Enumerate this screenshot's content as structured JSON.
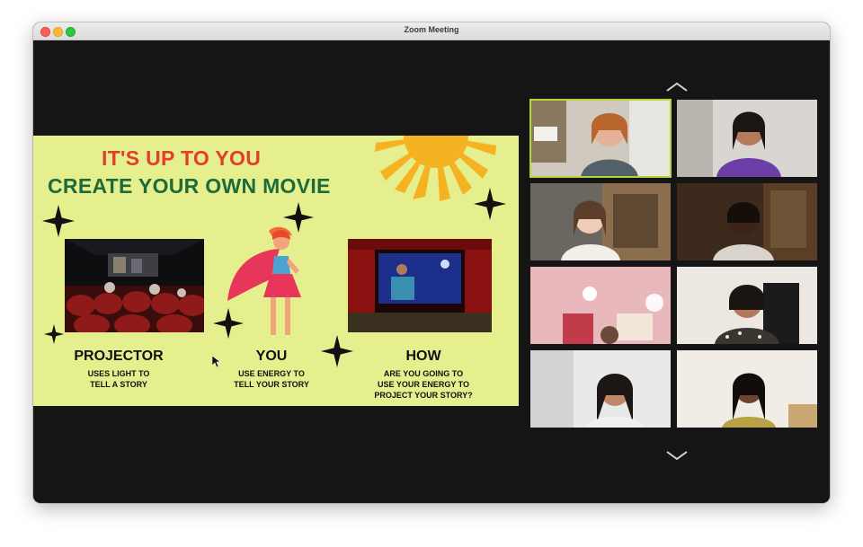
{
  "window": {
    "title": "Zoom Meeting"
  },
  "slide": {
    "title_line1": "IT'S UP TO YOU",
    "title_line2": "CREATE YOUR OWN MOVIE",
    "panels": [
      {
        "heading": "PROJECTOR",
        "line1": "USES LIGHT TO",
        "line2": "TELL A STORY",
        "line3": ""
      },
      {
        "heading": "YOU",
        "line1": "USE ENERGY TO",
        "line2": "TELL YOUR STORY",
        "line3": ""
      },
      {
        "heading": "HOW",
        "line1": "ARE YOU GOING TO",
        "line2": "USE YOUR ENERGY TO",
        "line3": "PROJECT YOUR STORY?"
      }
    ]
  },
  "gallery": {
    "participants": [
      {
        "icon": "participant-video",
        "active": true
      },
      {
        "icon": "participant-video",
        "active": false
      },
      {
        "icon": "participant-video",
        "active": false
      },
      {
        "icon": "participant-video",
        "active": false
      },
      {
        "icon": "participant-video",
        "active": false
      },
      {
        "icon": "participant-video",
        "active": false
      },
      {
        "icon": "participant-video",
        "active": false
      },
      {
        "icon": "participant-video",
        "active": false
      }
    ],
    "nav_up_icon": "chevron-up-icon",
    "nav_down_icon": "chevron-down-icon"
  },
  "colors": {
    "slide_background": "#e6ef8d",
    "title_red": "#e23e2b",
    "title_green": "#1d6b3b",
    "active_speaker_border": "#b7d63a"
  }
}
